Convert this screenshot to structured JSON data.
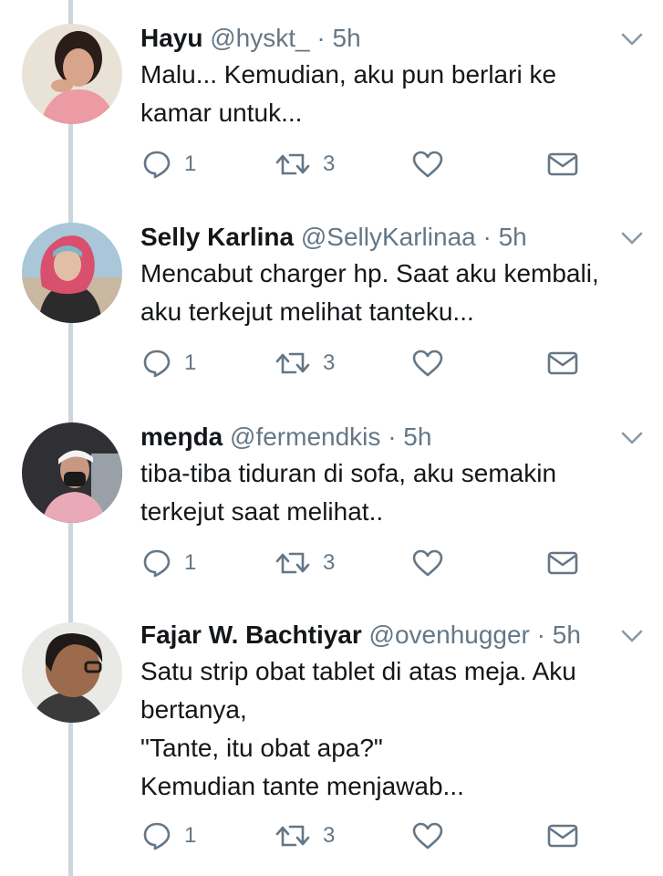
{
  "tweets": [
    {
      "name": "Hayu",
      "handle": "@hyskt_",
      "separator": "·",
      "time": "5h",
      "lines": [
        "Malu... Kemudian, aku pun berlari ke",
        "kamar untuk..."
      ],
      "reply_count": "1",
      "retweet_count": "3",
      "avatar_colors": {
        "bg": "#e9e2d6",
        "skin": "#d8a48a",
        "hair": "#2a1c18",
        "shirt": "#ec9aa3"
      }
    },
    {
      "name": "Selly Karlina",
      "handle": "@SellyKarlinaa",
      "separator": "·",
      "time": "5h",
      "lines": [
        "Mencabut charger hp. Saat aku kembali,",
        "aku terkejut melihat tanteku..."
      ],
      "reply_count": "1",
      "retweet_count": "3",
      "avatar_colors": {
        "bg": "#a9c7d8",
        "skin": "#e2bea6",
        "hair": "#d94f6e",
        "shirt": "#2b2b2b"
      }
    },
    {
      "name": "meŋda",
      "handle": "@fermendkis",
      "separator": "·",
      "time": "5h",
      "lines": [
        "tiba-tiba tiduran di sofa, aku semakin",
        "terkejut saat melihat.."
      ],
      "reply_count": "1",
      "retweet_count": "3",
      "avatar_colors": {
        "bg": "#2f2f34",
        "skin": "#c99883",
        "hair": "#f3f3f3",
        "shirt": "#e9a9b6"
      }
    },
    {
      "name": "Fajar W. Bachtiyar",
      "handle": "@ovenhugger",
      "separator": "·",
      "time": "5h",
      "lines": [
        "Satu strip obat tablet di atas meja. Aku",
        "bertanya,",
        "\"Tante, itu obat apa?\"",
        "Kemudian tante menjawab..."
      ],
      "reply_count": "1",
      "retweet_count": "3",
      "avatar_colors": {
        "bg": "#e9e9e6",
        "skin": "#9c6b4e",
        "hair": "#1f1a17",
        "shirt": "#3a3a3a"
      }
    }
  ],
  "colors": {
    "text": "#14171a",
    "secondary": "#657786",
    "thread_line": "#ccd6dd",
    "icon": "#657786"
  },
  "icons": {
    "reply": "speech-bubble",
    "retweet": "retweet-arrows",
    "like": "heart-outline",
    "dm": "envelope",
    "more": "chevron-down"
  }
}
